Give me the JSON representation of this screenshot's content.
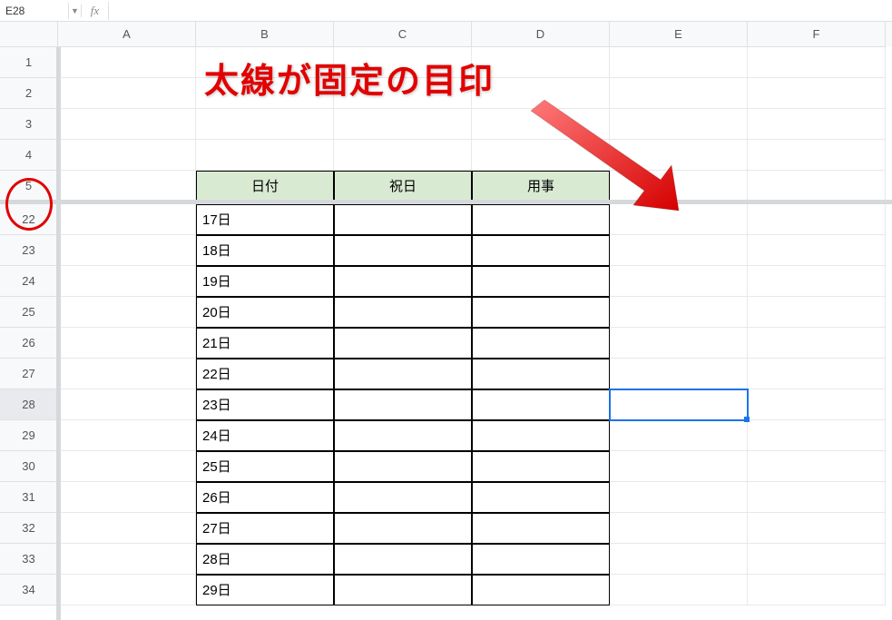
{
  "namebox": {
    "value": "E28",
    "fx": "fx"
  },
  "columns": [
    "A",
    "B",
    "C",
    "D",
    "E",
    "F"
  ],
  "frozenRows": [
    "1",
    "2",
    "3",
    "4",
    "5"
  ],
  "bodyRows": [
    "22",
    "23",
    "24",
    "25",
    "26",
    "27",
    "28",
    "29",
    "30",
    "31",
    "32",
    "33",
    "34"
  ],
  "tableHeaders": {
    "b": "日付",
    "c": "祝日",
    "d": "用事"
  },
  "tableData": {
    "22": "17日",
    "23": "18日",
    "24": "19日",
    "25": "20日",
    "26": "21日",
    "27": "22日",
    "28": "23日",
    "29": "24日",
    "30": "25日",
    "31": "26日",
    "32": "27日",
    "33": "28日",
    "34": "29日"
  },
  "annotation": "太線が固定の目印",
  "activeCell": {
    "col": "E",
    "row": "28"
  }
}
